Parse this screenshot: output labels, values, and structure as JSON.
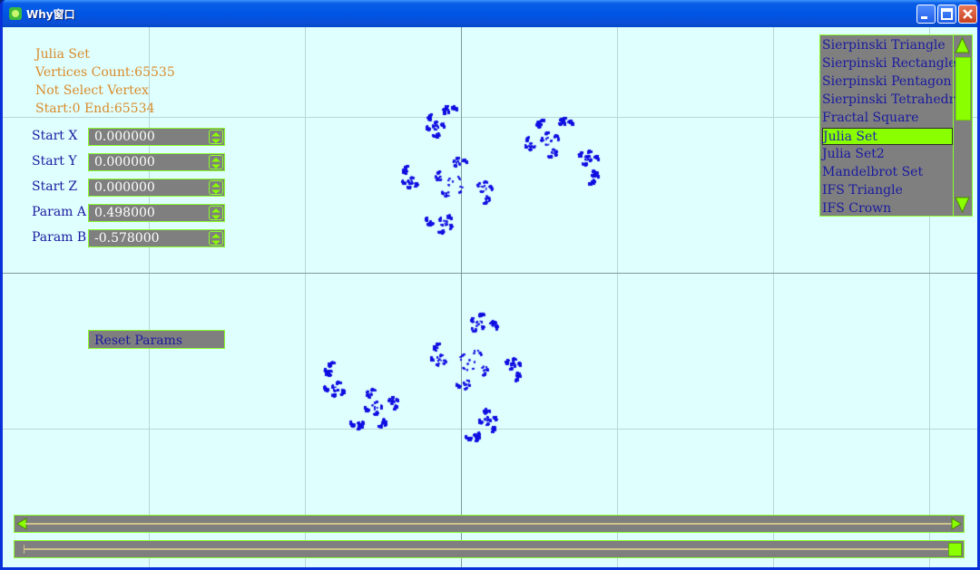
{
  "window": {
    "title": "Why窗口"
  },
  "info": {
    "fractal_name": "Julia Set",
    "vertices": "Vertices Count:65535",
    "selection": "Not Select Vertex",
    "range": "Start:0 End:65534"
  },
  "params": [
    {
      "label": "Start X",
      "value": "0.000000"
    },
    {
      "label": "Start Y",
      "value": "0.000000"
    },
    {
      "label": "Start Z",
      "value": "0.000000"
    },
    {
      "label": "Param A",
      "value": "0.498000"
    },
    {
      "label": "Param B",
      "value": "-0.578000"
    }
  ],
  "reset_label": "Reset Params",
  "fractal_list": {
    "items": [
      "Sierpinski Triangle",
      "Sierpinski Rectangle",
      "Sierpinski Pentagon",
      "Sierpinski Tetrahedron",
      "Fractal Square",
      "Julia Set",
      "Julia Set2",
      "Mandelbrot Set",
      "IFS Triangle",
      "IFS Crown"
    ],
    "selected_index": 5
  },
  "colors": {
    "point": "#1010e0",
    "accent": "#8aff00",
    "panel": "#7f7f7f",
    "label": "#d98a2a"
  },
  "sliders": {
    "bottom_slider_position": 1.0
  }
}
